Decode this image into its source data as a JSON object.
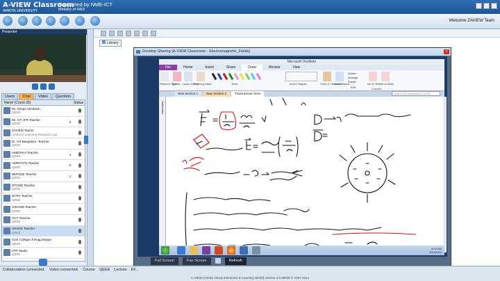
{
  "app": {
    "brand_line1": "A-VIEW Classroom",
    "brand_line2": "AMRITA UNIVERSITY",
    "support_line1": "Supported by NME-ICT",
    "support_line2": "Ministry of HRD",
    "welcome": "Welcome ZAVIEW Team"
  },
  "left_panel": {
    "presenter_label": "Presenter",
    "tabs": [
      {
        "label": "Users"
      },
      {
        "label": "Chat"
      },
      {
        "label": "Video"
      },
      {
        "label": "Question"
      }
    ],
    "table_headers": {
      "name": "Name (Count 35)",
      "count": "",
      "status": "Status"
    },
    "users": [
      {
        "name": "Mr. Deepa Vembesh",
        "sub": "QEEE",
        "count": "",
        "icon": "mic-icon"
      },
      {
        "name": "Mr. VIT JFR Teacher",
        "sub": "QEEE",
        "count": "5",
        "icon": "status-dot"
      },
      {
        "name": "ZAVIEW Team2",
        "sub": "Amrita E-Learning Research Lab",
        "count": "",
        "icon": "status-dot"
      },
      {
        "name": "Dr. AIT Bangalore. Teacher",
        "sub": "QEEE",
        "count": "",
        "icon": "status-dot"
      },
      {
        "name": "AMBTAKA Teacher",
        "sub": "QEEE",
        "count": "4",
        "icon": "status-dot"
      },
      {
        "name": "AMRITATN Teacher",
        "sub": "QEEE",
        "count": "2",
        "icon": "status-dot"
      },
      {
        "name": "BEPUNE Teacher",
        "sub": "QEEE",
        "count": "1",
        "icon": "status-dot"
      },
      {
        "name": "DTCMD Teacher",
        "sub": "QEEE",
        "count": "",
        "icon": "status-dot"
      },
      {
        "name": "DCRV Teacher",
        "sub": "QEEE",
        "count": "",
        "icon": "status-dot"
      },
      {
        "name": "GIDAMD Teacher",
        "sub": "QEEE",
        "count": "",
        "icon": "status-dot"
      },
      {
        "name": "GCT Teacher",
        "sub": "QEEE",
        "count": "",
        "icon": "status-dot"
      },
      {
        "name": "GKNCE Teacher",
        "sub": "QEEE",
        "count": "",
        "icon": "status-dot"
      },
      {
        "name": "Govt College of Engg Bargur",
        "sub": "QEEE",
        "count": "",
        "icon": "status-dot"
      },
      {
        "name": "IITR Studio",
        "sub": "QEEE",
        "count": "",
        "icon": "status-dot"
      }
    ]
  },
  "main": {
    "library_label": "Library"
  },
  "desktop_share": {
    "title": "Desktop Sharing (A-VIEW Classroom - Electromagnetic_Fields)",
    "onenote_title": "Microsoft OneNote",
    "ribbon_tabs": [
      "File",
      "Home",
      "Insert",
      "Share",
      "Draw",
      "Review",
      "View"
    ],
    "ribbon_labels": {
      "select": "Select & Type",
      "eraser": "Eraser",
      "lasso": "Lasso Select",
      "panning": "Panning Hand",
      "tools": "Tools",
      "insert_shapes": "Insert Shapes",
      "color": "Color & Thickness",
      "insert_space": "Insert Space",
      "delete": "Delete",
      "arrange": "Arrange",
      "rotate": "Rotate",
      "edit": "Edit",
      "ink_text": "Ink to Text",
      "ink_math": "Ink to Math",
      "convert": "Convert"
    },
    "section_tabs": [
      "New Section 1",
      "New Section 2",
      "Transmission lines"
    ],
    "search_placeholder": "Search All Notebooks (Ctrl+E)",
    "sidebar_label": "Notebooks",
    "clock_time": "8:29 AM",
    "clock_date": "3/13/2014",
    "buttons": {
      "full_screen": "Full Screen",
      "pan_screen": "Pan Screen",
      "refresh": "Refresh"
    }
  },
  "status": {
    "collab": "Collaboration connected.",
    "video": "Video connected.",
    "course_label": "Course",
    "course": "QEEE",
    "lecture_label": "Lecture",
    "lecture": "EF..."
  },
  "footer": "A-VIEW (Amrita Virtual Interactive E-Learning World) Version 3.6.9903b © 2007-2014"
}
